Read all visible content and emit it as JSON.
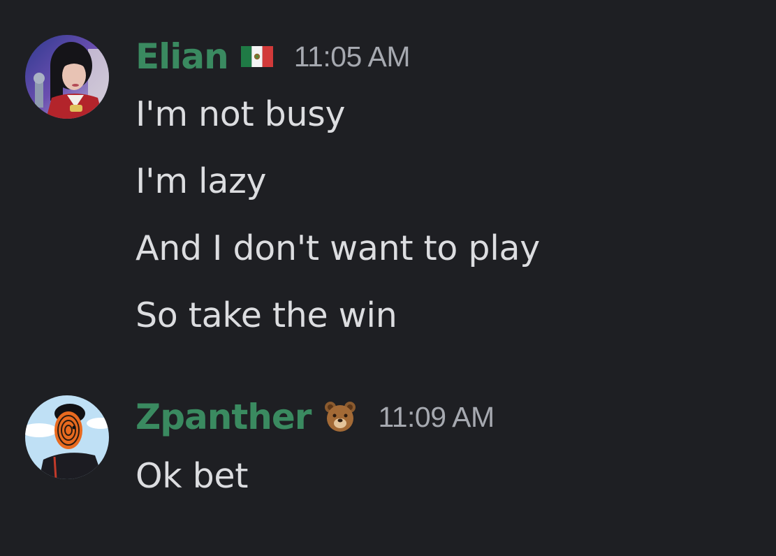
{
  "messages": [
    {
      "username": "Elian",
      "badge_icon": "mexico-flag-icon",
      "timestamp": "11:05 AM",
      "name_color": "#3a8a60",
      "lines": [
        "I'm not busy",
        "I'm lazy",
        "And I don't want to play",
        "So take the win"
      ]
    },
    {
      "username": "Zpanther",
      "badge_icon": "bear-face-icon",
      "timestamp": "11:09 AM",
      "name_color": "#3a8a60",
      "lines": [
        "Ok bet"
      ]
    }
  ]
}
